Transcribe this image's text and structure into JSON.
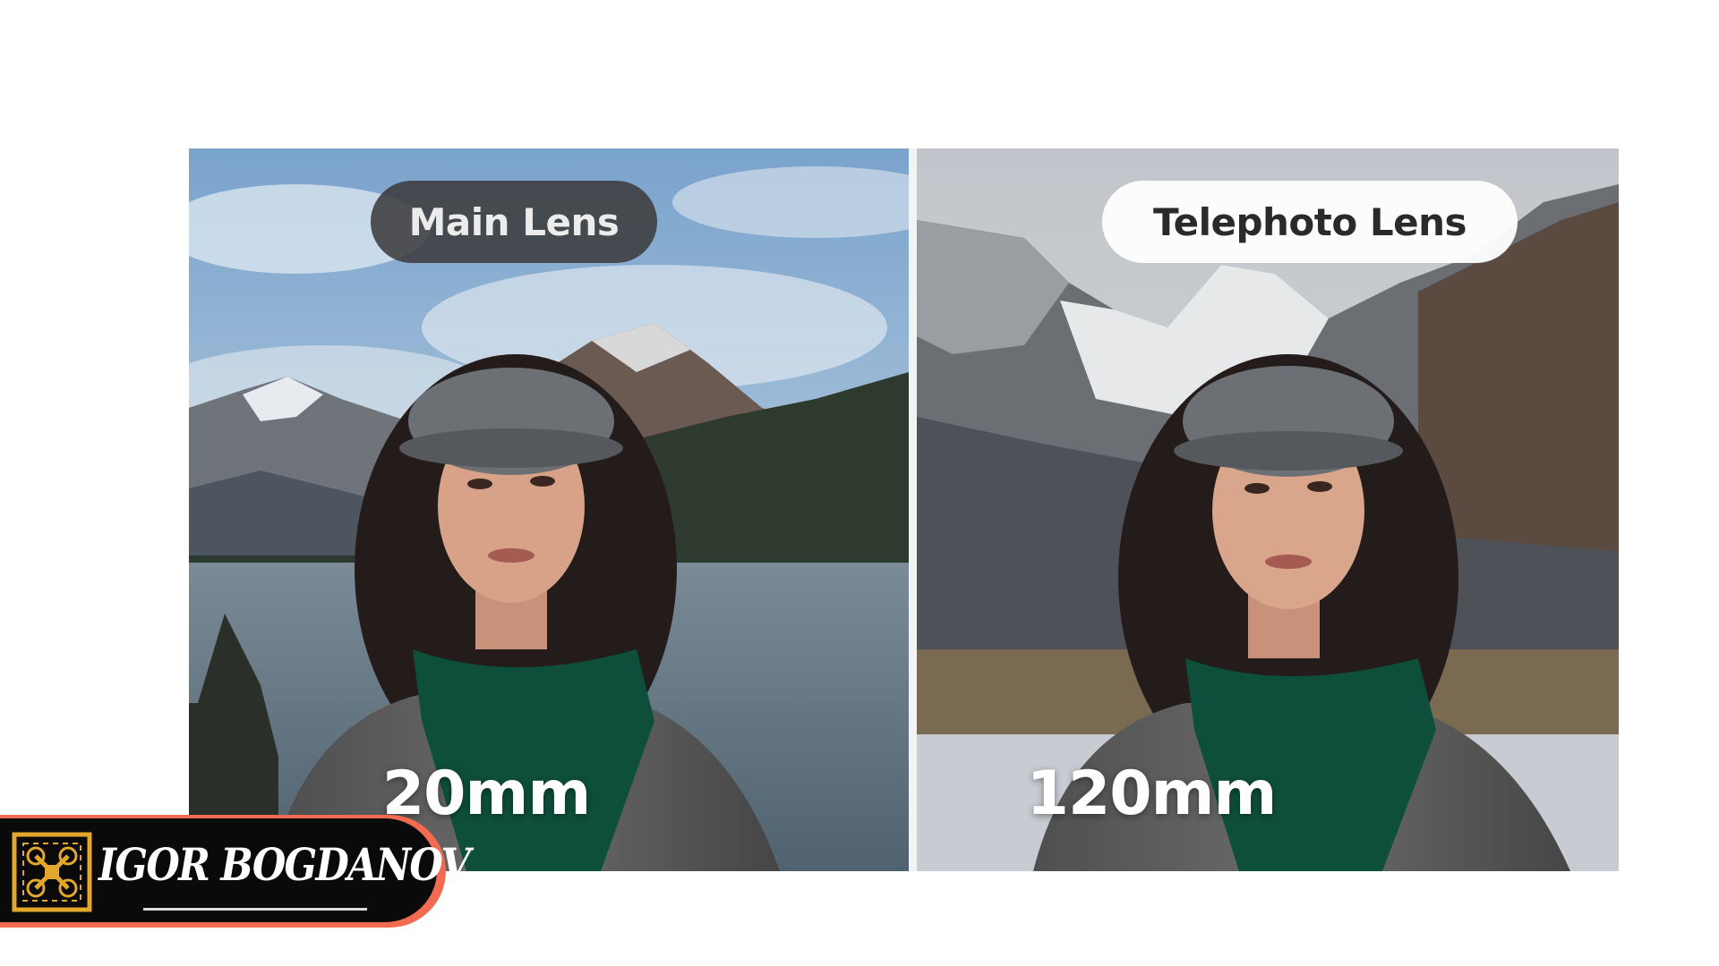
{
  "panels": {
    "left": {
      "label": "Main Lens",
      "focal_length": "20mm"
    },
    "right": {
      "label": "Telephoto Lens",
      "focal_length": "120mm"
    }
  },
  "watermark": {
    "text": "IGOR BOGDANOV"
  },
  "colors": {
    "background": "#ffffff",
    "pill_dark": "#3c3c3e",
    "pill_light": "#ffffff",
    "watermark_border": "#f26a4f",
    "watermark_fill": "#0a0a0a",
    "logo_gold": "#e2a72b",
    "scarf_green": "#0e4f3c"
  }
}
